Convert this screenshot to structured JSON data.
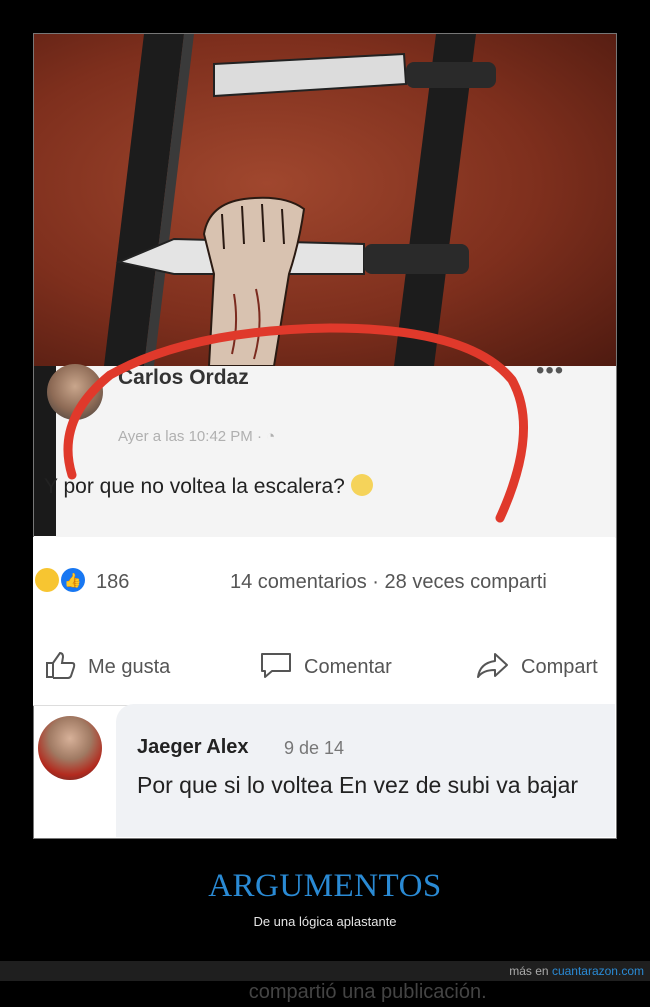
{
  "post": {
    "author": "Carlos Ordaz",
    "action": "compartió una publicación.",
    "timestamp": "Ayer a las 10:42 PM · ",
    "more": "•••",
    "text": "Y por que no voltea la escalera?",
    "reaction_count": "186",
    "stats": "14 comentarios · 28 veces comparti"
  },
  "actions": {
    "like": "Me gusta",
    "comment": "Comentar",
    "share": "Compart"
  },
  "comment": {
    "author": "Jaeger Alex",
    "time": "9 de 14",
    "text": "Por que si lo voltea En vez de subi va bajar"
  },
  "caption": {
    "title": "ARGUMENTOS",
    "subtitle": "De una lógica aplastante"
  },
  "footer": {
    "prefix": "más en ",
    "site": "cuantarazon.com"
  },
  "colors": {
    "accent": "#2a8ad4",
    "annotation": "#e0392b",
    "facebook_blue": "#1877f2"
  }
}
